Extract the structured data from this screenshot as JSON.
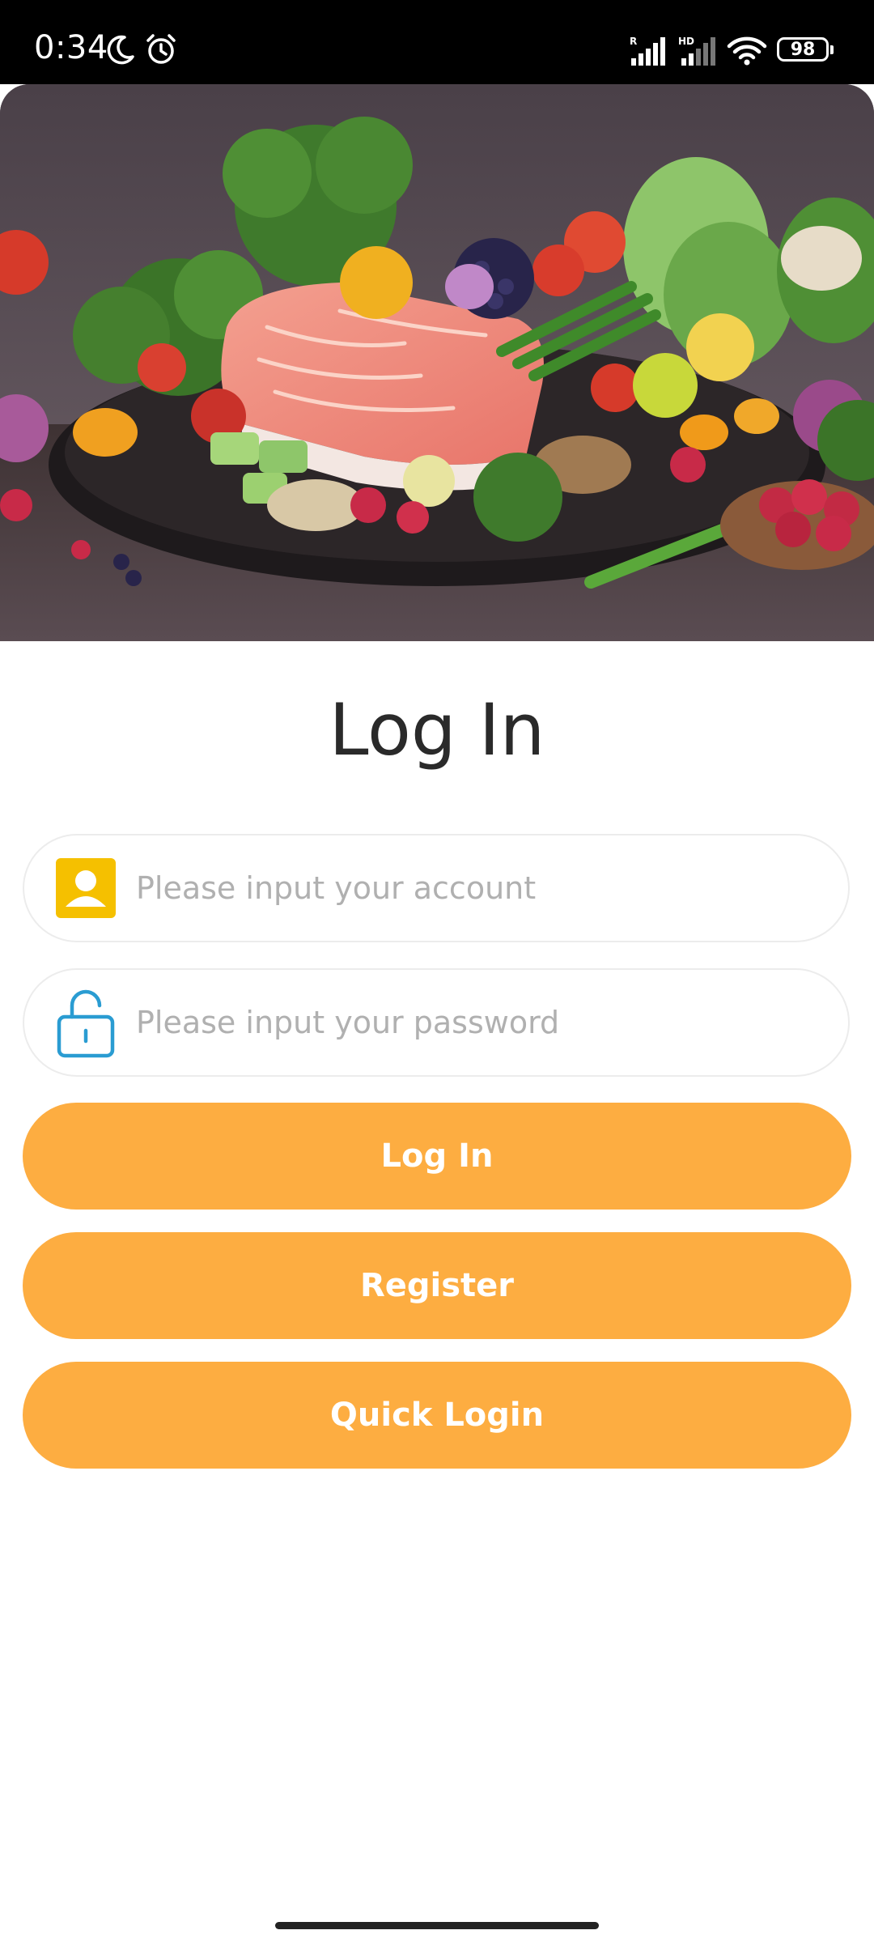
{
  "status_bar": {
    "time": "0:34",
    "battery": "98",
    "signal_1_label": "R",
    "signal_2_label": "HD",
    "icons": [
      "moon-icon",
      "alarm-icon",
      "signal-icon",
      "signal-hd-icon",
      "wifi-icon",
      "battery-icon"
    ]
  },
  "hero": {
    "icon": "food-platter-image"
  },
  "login": {
    "title": "Log In",
    "account_placeholder": "Please input your account",
    "password_placeholder": "Please input your password",
    "login_button": "Log In",
    "register_button": "Register",
    "quick_login_button": "Quick Login"
  },
  "colors": {
    "accent": "#fdad41",
    "account_icon": "#f5c000",
    "password_icon": "#2a9cd2",
    "title_text": "#2a2a2a",
    "placeholder_text": "#b0b0b0"
  }
}
